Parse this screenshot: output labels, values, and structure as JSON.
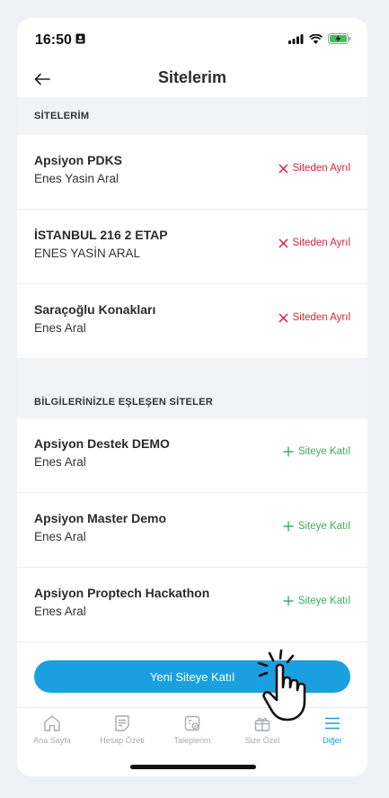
{
  "status_bar": {
    "time": "16:50"
  },
  "nav": {
    "title": "Sitelerim"
  },
  "section_my_sites": {
    "header": "SİTELERİM",
    "action_label": "Siteden Ayrıl",
    "items": [
      {
        "title": "Apsiyon PDKS",
        "subtitle": "Enes Yasin Aral"
      },
      {
        "title": "İSTANBUL 216 2 ETAP",
        "subtitle": "ENES YASİN ARAL"
      },
      {
        "title": "Saraçoğlu Konakları",
        "subtitle": "Enes Aral"
      }
    ]
  },
  "section_matching": {
    "header": "BİLGİLERİNİZLE EŞLEŞEN SİTELER",
    "action_label": "Siteye Katıl",
    "items": [
      {
        "title": "Apsiyon Destek DEMO",
        "subtitle": "Enes Aral"
      },
      {
        "title": "Apsiyon Master Demo",
        "subtitle": "Enes Aral"
      },
      {
        "title": "Apsiyon Proptech Hackathon",
        "subtitle": "Enes Aral"
      }
    ]
  },
  "cta": {
    "label": "Yeni Siteye Katıl"
  },
  "tabbar": {
    "items": [
      {
        "label": "Ana Sayfa",
        "icon": "home-icon"
      },
      {
        "label": "Hesap Özeti",
        "icon": "statement-icon"
      },
      {
        "label": "Taleplerim",
        "icon": "requests-icon"
      },
      {
        "label": "Size Özel",
        "icon": "gift-icon"
      },
      {
        "label": "Diğer",
        "icon": "menu-icon",
        "active": true
      }
    ]
  },
  "colors": {
    "accent": "#1aa0e0",
    "leave": "#d81f3f",
    "join": "#3cae5a"
  }
}
